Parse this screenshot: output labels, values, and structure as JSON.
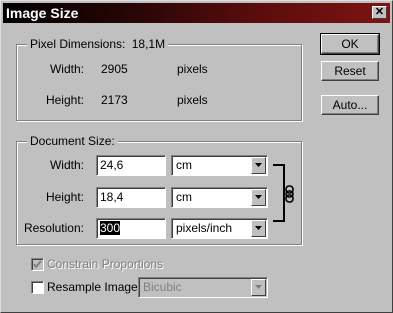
{
  "window": {
    "title": "Image Size",
    "close_glyph": "✕"
  },
  "buttons": {
    "ok": "OK",
    "reset": "Reset",
    "auto": "Auto..."
  },
  "pixel_dimensions": {
    "label": "Pixel Dimensions:",
    "size": "18,1M",
    "width_label": "Width:",
    "width_value": "2905",
    "width_unit": "pixels",
    "height_label": "Height:",
    "height_value": "2173",
    "height_unit": "pixels"
  },
  "document_size": {
    "label": "Document Size:",
    "width_label": "Width:",
    "width_value": "24,6",
    "width_unit": "cm",
    "height_label": "Height:",
    "height_value": "18,4",
    "height_unit": "cm",
    "resolution_label": "Resolution:",
    "resolution_value": "300",
    "resolution_unit": "pixels/inch",
    "link_icon": "chain-link-icon"
  },
  "options": {
    "constrain_label": "Constrain Proportions",
    "constrain_checked": true,
    "resample_label": "Resample Image:",
    "resample_checked": false,
    "resample_method": "Bicubic"
  }
}
